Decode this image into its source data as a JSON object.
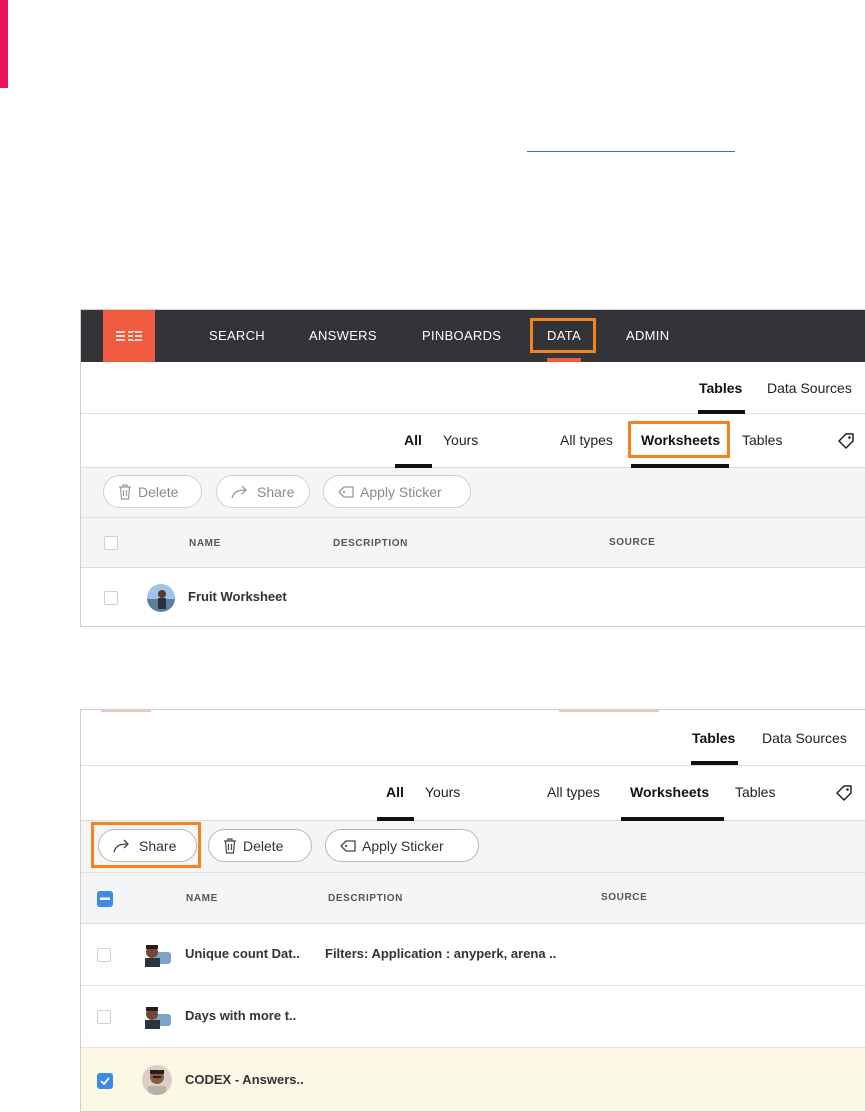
{
  "colors": {
    "accent": "#f05a40",
    "highlight": "#f5821f",
    "nav_bg": "#333437",
    "selected_row": "#fcf8e6",
    "checkbox_blue": "#3c8be5"
  },
  "panel1": {
    "nav": {
      "search": "SEARCH",
      "answers": "ANSWERS",
      "pinboards": "PINBOARDS",
      "data": "DATA",
      "admin": "ADMIN"
    },
    "tabs": {
      "tables": "Tables",
      "data_sources": "Data Sources"
    },
    "filters": {
      "all": "All",
      "yours": "Yours",
      "all_types": "All types",
      "worksheets": "Worksheets",
      "tables": "Tables"
    },
    "actions": {
      "delete": "Delete",
      "share": "Share",
      "apply_sticker": "Apply Sticker"
    },
    "columns": {
      "name": "NAME",
      "description": "DESCRIPTION",
      "source": "SOURCE"
    },
    "rows": [
      {
        "name": "Fruit Worksheet",
        "checked": false
      }
    ]
  },
  "panel2": {
    "tabs": {
      "tables": "Tables",
      "data_sources": "Data Sources"
    },
    "filters": {
      "all": "All",
      "yours": "Yours",
      "all_types": "All types",
      "worksheets": "Worksheets",
      "tables": "Tables"
    },
    "actions": {
      "share": "Share",
      "delete": "Delete",
      "apply_sticker": "Apply Sticker"
    },
    "columns": {
      "name": "NAME",
      "description": "DESCRIPTION",
      "source": "SOURCE"
    },
    "rows": [
      {
        "name": "Unique count Dat..",
        "description": "Filters: Application : anyperk, arena ..",
        "checked": false
      },
      {
        "name": "Days with more t..",
        "description": "",
        "checked": false
      },
      {
        "name": "CODEX - Answers..",
        "description": "",
        "checked": true
      }
    ]
  }
}
